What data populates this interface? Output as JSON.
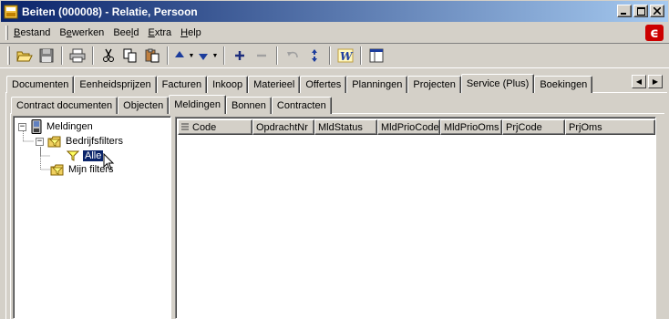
{
  "window": {
    "title": "Beiten (000008) - Relatie, Persoon",
    "minimize_icon": "minimize-icon",
    "maximize_icon": "maximize-icon",
    "close_icon": "close-icon"
  },
  "menu": {
    "items": [
      {
        "label": "Bestand",
        "key": "B"
      },
      {
        "label": "Bewerken",
        "key": "e"
      },
      {
        "label": "Beeld",
        "key": "l"
      },
      {
        "label": "Extra",
        "key": "E"
      },
      {
        "label": "Help",
        "key": "H"
      }
    ],
    "brand_logo": "ϵ"
  },
  "toolbar": {
    "icons": [
      "open-folder-icon",
      "save-icon",
      "print-icon",
      "cut-icon",
      "copy-icon",
      "paste-icon",
      "arrow-up-icon",
      "arrow-down-icon",
      "plus-icon",
      "minus-icon",
      "undo-icon",
      "refresh-icon",
      "word-icon",
      "window-icon"
    ]
  },
  "outer_tabs": {
    "items": [
      "Documenten",
      "Eenheidsprijzen",
      "Facturen",
      "Inkoop",
      "Materieel",
      "Offertes",
      "Planningen",
      "Projecten",
      "Service (Plus)",
      "Boekingen"
    ],
    "active": "Service (Plus)"
  },
  "inner_tabs": {
    "items": [
      "Contract documenten",
      "Objecten",
      "Meldingen",
      "Bonnen",
      "Contracten"
    ],
    "active": "Meldingen"
  },
  "tree": {
    "root": "Meldingen",
    "group1": "Bedrijfsfilters",
    "group1_child": "Alle",
    "group2": "Mijn filters",
    "expanded_symbol": "−"
  },
  "list": {
    "columns": [
      "Code",
      "OpdrachtNr",
      "MldStatus",
      "MldPrioCode",
      "MldPrioOms",
      "PrjCode",
      "PrjOms"
    ]
  },
  "colors": {
    "title_start": "#0a246a",
    "title_end": "#a6caf0",
    "face": "#d4d0c8",
    "brand": "#cc0000"
  }
}
